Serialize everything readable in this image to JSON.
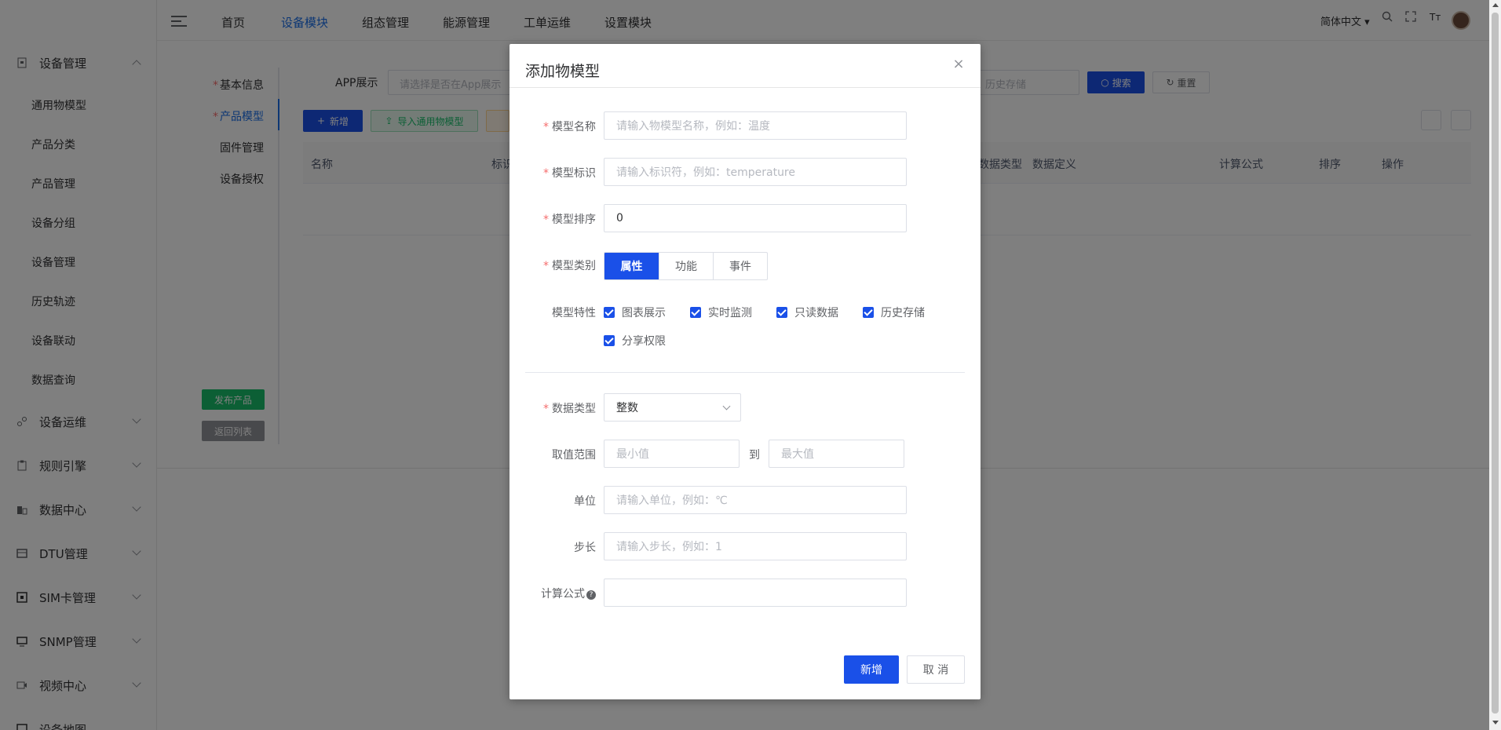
{
  "topbar": {
    "nav": [
      "首页",
      "设备模块",
      "组态管理",
      "能源管理",
      "工单运维",
      "设置模块"
    ],
    "active_index": 1,
    "language": "简体中文"
  },
  "sidebar": {
    "group_device": "设备管理",
    "sub_items": [
      "通用物模型",
      "产品分类",
      "产品管理",
      "设备分组",
      "设备管理",
      "历史轨迹",
      "设备联动",
      "数据查询"
    ],
    "groups": [
      "设备运维",
      "规则引擎",
      "数据中心",
      "DTU管理",
      "SIM卡管理",
      "SNMP管理",
      "视频中心",
      "设备地图"
    ]
  },
  "content": {
    "vtabs": [
      "基本信息",
      "产品模型",
      "固件管理",
      "设备授权"
    ],
    "publish_btn": "发布产品",
    "back_btn": "返回列表",
    "filter_label": "APP展示",
    "filter_placeholder": "请选择是否在App展示",
    "filter2_placeholder": "历史存储",
    "search_btn": "搜索",
    "reset_btn": "重置",
    "add_btn": "新增",
    "import_btn": "导入通用物模型",
    "columns": [
      "名称",
      "标识",
      "数据类型",
      "数据定义",
      "计算公式",
      "排序",
      "操作"
    ]
  },
  "dialog": {
    "title": "添加物模型",
    "name_label": "模型名称",
    "name_placeholder": "请输入物模型名称，例如：温度",
    "id_label": "模型标识",
    "id_placeholder": "请输入标识符，例如：temperature",
    "order_label": "模型排序",
    "order_value": "0",
    "category_label": "模型类别",
    "categories": [
      "属性",
      "功能",
      "事件"
    ],
    "feature_label": "模型特性",
    "features": [
      "图表展示",
      "实时监测",
      "只读数据",
      "历史存储",
      "分享权限"
    ],
    "datatype_label": "数据类型",
    "datatype_value": "整数",
    "range_label": "取值范围",
    "min_placeholder": "最小值",
    "range_to": "到",
    "max_placeholder": "最大值",
    "unit_label": "单位",
    "unit_placeholder": "请输入单位，例如：℃",
    "step_label": "步长",
    "step_placeholder": "请输入步长，例如：1",
    "formula_label": "计算公式",
    "formula_value": "",
    "submit_btn": "新增",
    "cancel_btn": "取 消"
  },
  "colors": {
    "primary": "#1a50e8",
    "link": "#1a6fe8",
    "success": "#19be6b",
    "danger": "#f56c6c"
  }
}
